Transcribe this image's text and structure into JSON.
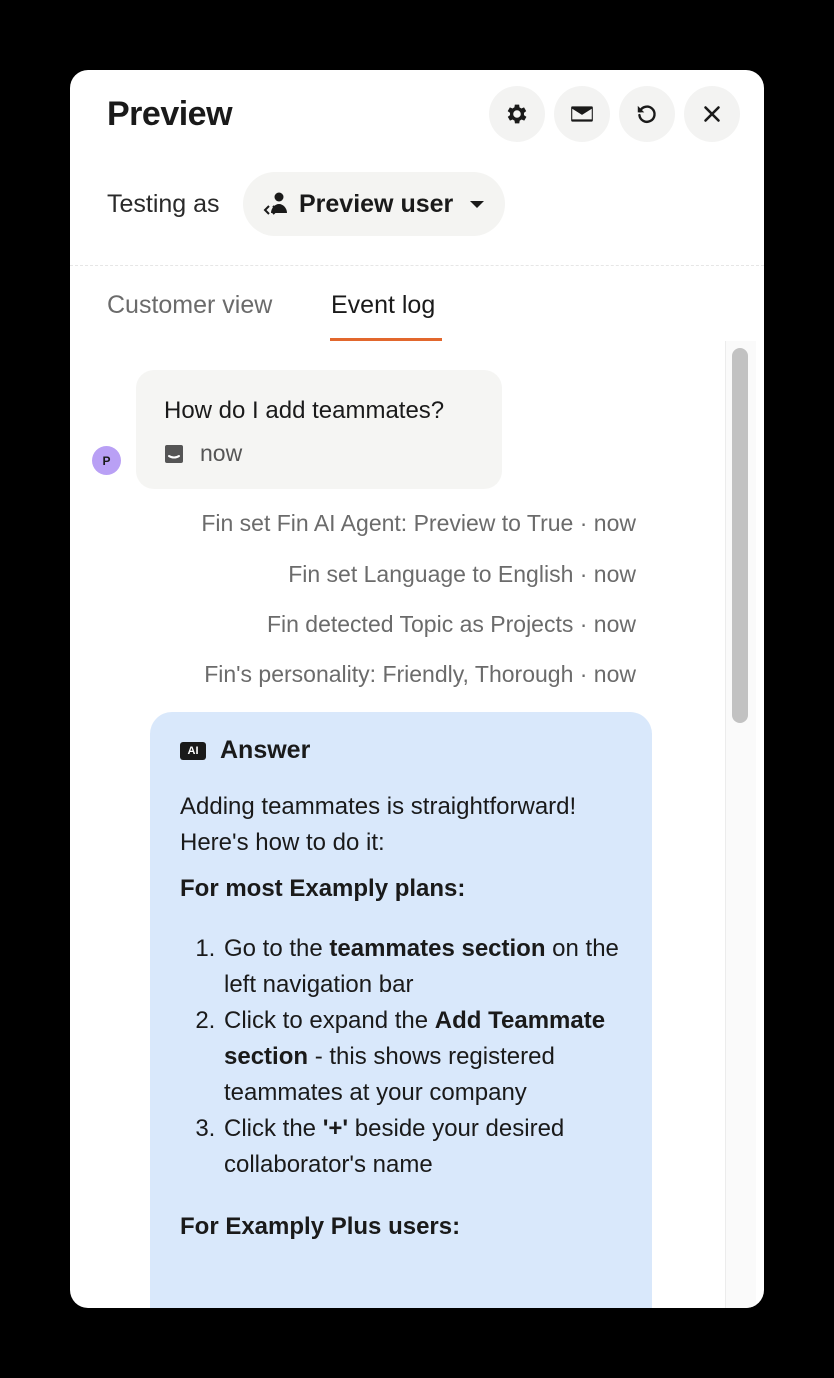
{
  "header": {
    "title": "Preview"
  },
  "testing": {
    "label": "Testing as",
    "user": "Preview user"
  },
  "tabs": [
    {
      "label": "Customer view",
      "active": false
    },
    {
      "label": "Event log",
      "active": true
    }
  ],
  "message": {
    "text": "How do I add teammates?",
    "time": "now",
    "avatar": "P"
  },
  "events": [
    "Fin set Fin AI Agent: Preview to True · now",
    "Fin set Language to English · now",
    "Fin detected Topic as Projects · now",
    "Fin's personality: Friendly, Thorough · now"
  ],
  "answer": {
    "badge": "AI",
    "title": "Answer",
    "intro": "Adding teammates is straightforward! Here's how to do it:",
    "section1": "For most Examply plans:",
    "steps": [
      {
        "pre": "Go to the ",
        "bold": "teammates section",
        "post": " on the left navigation bar"
      },
      {
        "pre": "Click to expand the ",
        "bold": "Add Teammate section",
        "post": " - this shows registered teammates at your company"
      },
      {
        "pre": "Click the ",
        "bold": "'+'",
        "post": " beside your desired collaborator's name"
      }
    ],
    "section2": "For Examply Plus users:"
  },
  "colors": {
    "accent": "#e2672d",
    "answer_bg": "#d9e8fb",
    "avatar_bg": "#b9a0f5"
  },
  "icons": [
    "gear-icon",
    "mail-icon",
    "reset-icon",
    "close-icon",
    "user-icon",
    "caret-down-icon",
    "chat-icon"
  ]
}
